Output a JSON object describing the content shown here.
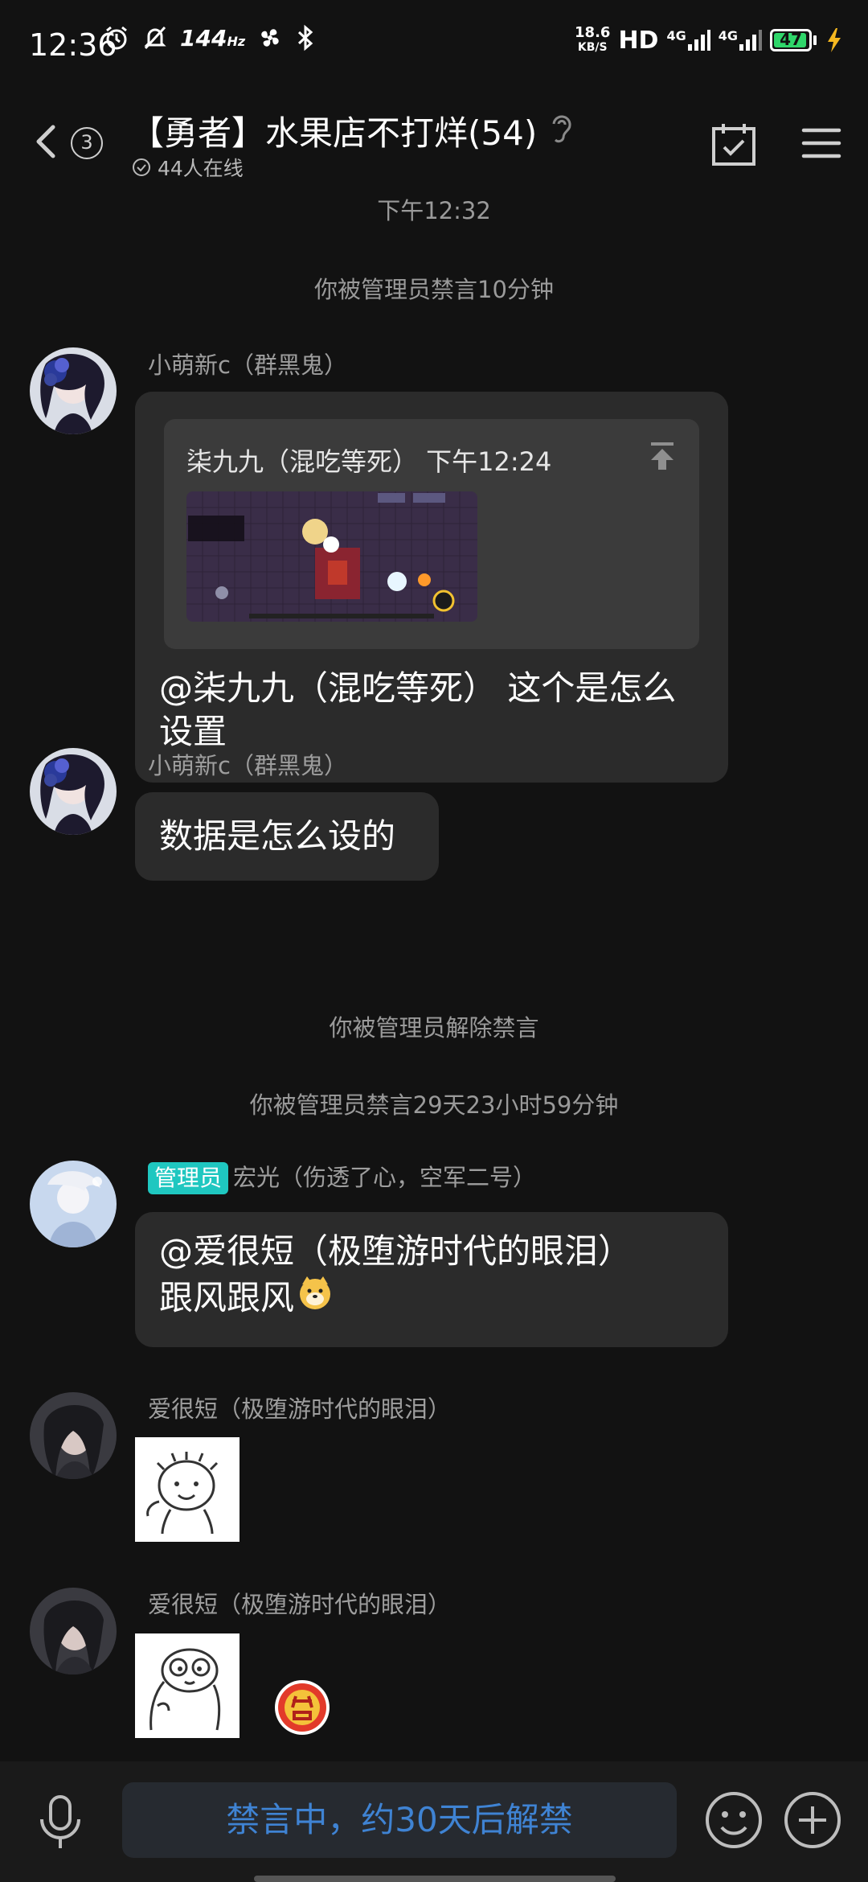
{
  "status_bar": {
    "time": "12:36",
    "refresh_rate": "144",
    "refresh_unit": "Hz",
    "net_speed_value": "18.6",
    "net_speed_unit": "KB/S",
    "hd_label": "HD",
    "network_1": "4G",
    "network_2": "4G",
    "battery_level": "47",
    "battery_color": "#2fd66a"
  },
  "header": {
    "unread_count": "3",
    "title": "【勇者】水果店不打烊(54)",
    "online_text": "44人在线"
  },
  "messages": {
    "time_divider": "下午12:32",
    "sys_mute_1": "你被管理员禁言10分钟",
    "msg1": {
      "sender": "小萌新c（群黑鬼）",
      "quote_header": "柒九九（混吃等死） 下午12:24",
      "text": "@柒九九（混吃等死） 这个是怎么设置"
    },
    "msg2": {
      "sender": "小萌新c（群黑鬼）",
      "text": "数据是怎么设的"
    },
    "sys_unmute": "你被管理员解除禁言",
    "sys_mute_2": "你被管理员禁言29天23小时59分钟",
    "msg3": {
      "badge": "管理员",
      "sender": "宏光（伤透了心，空军二号）",
      "text_line1": "@爱很短（极堕游时代的眼泪）",
      "text_line2": "跟风跟风"
    },
    "msg4": {
      "sender": "爱很短（极堕游时代的眼泪）"
    },
    "msg5": {
      "sender": "爱很短（极堕游时代的眼泪）"
    }
  },
  "input_bar": {
    "muted_text": "禁言中，约30天后解禁"
  },
  "colors": {
    "background": "#121212",
    "bubble": "#2b2b2b",
    "admin_badge": "#1fc7c0",
    "muted_text": "#3f83d3"
  }
}
